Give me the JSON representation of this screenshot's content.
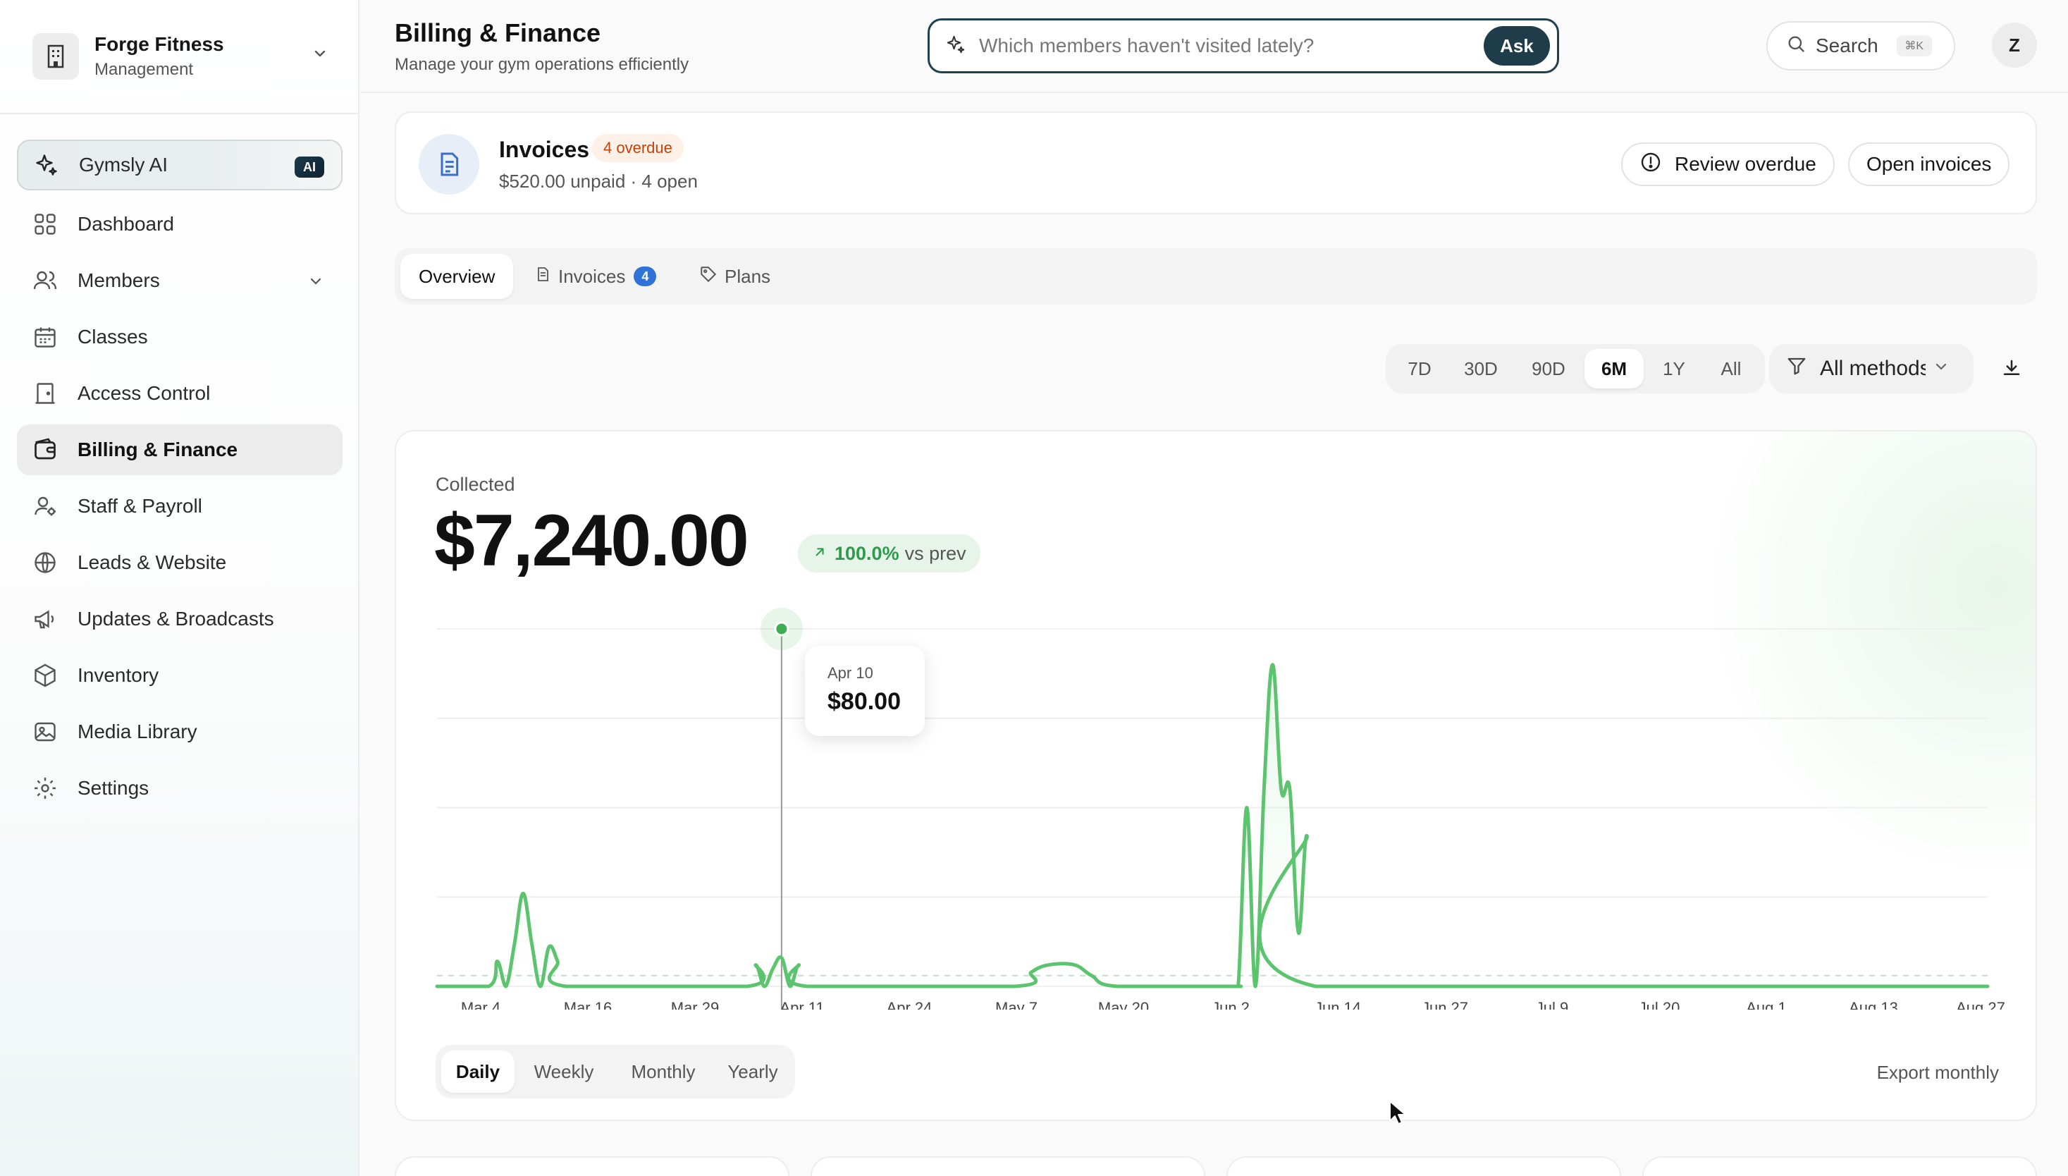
{
  "org": {
    "name": "Forge Fitness",
    "subtitle": "Management",
    "icon": "building-icon"
  },
  "sidebar": {
    "items": [
      {
        "label": "Gymsly AI",
        "icon": "sparkles-icon",
        "badge": "AI"
      },
      {
        "label": "Dashboard",
        "icon": "grid-icon"
      },
      {
        "label": "Members",
        "icon": "users-icon",
        "expandable": true
      },
      {
        "label": "Classes",
        "icon": "calendar-icon"
      },
      {
        "label": "Access Control",
        "icon": "door-icon"
      },
      {
        "label": "Billing & Finance",
        "icon": "wallet-icon",
        "active": true
      },
      {
        "label": "Staff & Payroll",
        "icon": "user-cog-icon"
      },
      {
        "label": "Leads & Website",
        "icon": "globe-icon"
      },
      {
        "label": "Updates & Broadcasts",
        "icon": "megaphone-icon"
      },
      {
        "label": "Inventory",
        "icon": "box-icon"
      },
      {
        "label": "Media Library",
        "icon": "image-icon"
      },
      {
        "label": "Settings",
        "icon": "gear-icon"
      }
    ]
  },
  "header": {
    "title": "Billing & Finance",
    "subtitle": "Manage your gym operations efficiently",
    "ask_placeholder": "Which members haven't visited lately?",
    "ask_button": "Ask",
    "search_label": "Search",
    "search_shortcut": "⌘K",
    "avatar_initial": "Z"
  },
  "invoices_banner": {
    "title": "Invoices",
    "overdue_badge": "4 overdue",
    "summary": "$520.00 unpaid · 4 open",
    "review_button": "Review overdue",
    "open_button": "Open invoices"
  },
  "tabs": [
    {
      "label": "Overview",
      "active": true
    },
    {
      "label": "Invoices",
      "count": "4",
      "icon": "invoice-icon"
    },
    {
      "label": "Plans",
      "icon": "tag-icon"
    }
  ],
  "range": {
    "options": [
      "7D",
      "30D",
      "90D",
      "6M",
      "1Y",
      "All"
    ],
    "selected": "6M",
    "method_filter": "All methods"
  },
  "collected": {
    "label": "Collected",
    "value": "$7,240.00",
    "delta_pct": "100.0%",
    "delta_suffix": "vs prev"
  },
  "tooltip": {
    "date": "Apr 10",
    "value": "$80.00"
  },
  "granularity": {
    "options": [
      "Daily",
      "Weekly",
      "Monthly",
      "Yearly"
    ],
    "selected": "Daily"
  },
  "export_label": "Export monthly",
  "colors": {
    "accent": "#1e3c4a",
    "line": "#5cc46e",
    "positive": "#2e9a4a",
    "overdue": "#c2410c",
    "badge_blue": "#2f73d9"
  },
  "chart_data": {
    "type": "line",
    "x_tick_labels": [
      "Mar 4",
      "Mar 16",
      "Mar 29",
      "Apr 11",
      "Apr 24",
      "May 7",
      "May 20",
      "Jun 2",
      "Jun 14",
      "Jun 27",
      "Jul 9",
      "Jul 20",
      "Aug 1",
      "Aug 13",
      "Aug 27"
    ],
    "xlim": [
      "Mar 1",
      "Aug 28"
    ],
    "ylim": [
      0,
      1000
    ],
    "grid": true,
    "series": [
      {
        "points": [
          [
            "Mar 1",
            0
          ],
          [
            "Mar 7",
            0
          ],
          [
            "Mar 8",
            70
          ],
          [
            "Mar 9",
            0
          ],
          [
            "Mar 10",
            120
          ],
          [
            "Mar 11",
            260
          ],
          [
            "Mar 12",
            120
          ],
          [
            "Mar 13",
            0
          ],
          [
            "Mar 14",
            110
          ],
          [
            "Mar 15",
            70
          ],
          [
            "Mar 16",
            0
          ],
          [
            "Apr 6",
            0
          ],
          [
            "Apr 7",
            60
          ],
          [
            "Apr 8",
            0
          ],
          [
            "Apr 9",
            50
          ],
          [
            "Apr 10",
            80
          ],
          [
            "Apr 11",
            0
          ],
          [
            "Apr 12",
            60
          ],
          [
            "Apr 13",
            0
          ],
          [
            "May 7",
            0
          ],
          [
            "May 9",
            40
          ],
          [
            "May 11",
            60
          ],
          [
            "May 14",
            60
          ],
          [
            "May 16",
            30
          ],
          [
            "May 19",
            0
          ],
          [
            "Jun 1",
            0
          ],
          [
            "Jun 2",
            0
          ],
          [
            "Jun 3",
            500
          ],
          [
            "Jun 4",
            0
          ],
          [
            "Jun 5",
            550
          ],
          [
            "Jun 6",
            900
          ],
          [
            "Jun 7",
            550
          ],
          [
            "Jun 8",
            550
          ],
          [
            "Jun 9",
            150
          ],
          [
            "Jun 10",
            420
          ],
          [
            "Jun 11",
            0
          ],
          [
            "Aug 28",
            0
          ]
        ]
      }
    ],
    "reference_line": 30
  }
}
